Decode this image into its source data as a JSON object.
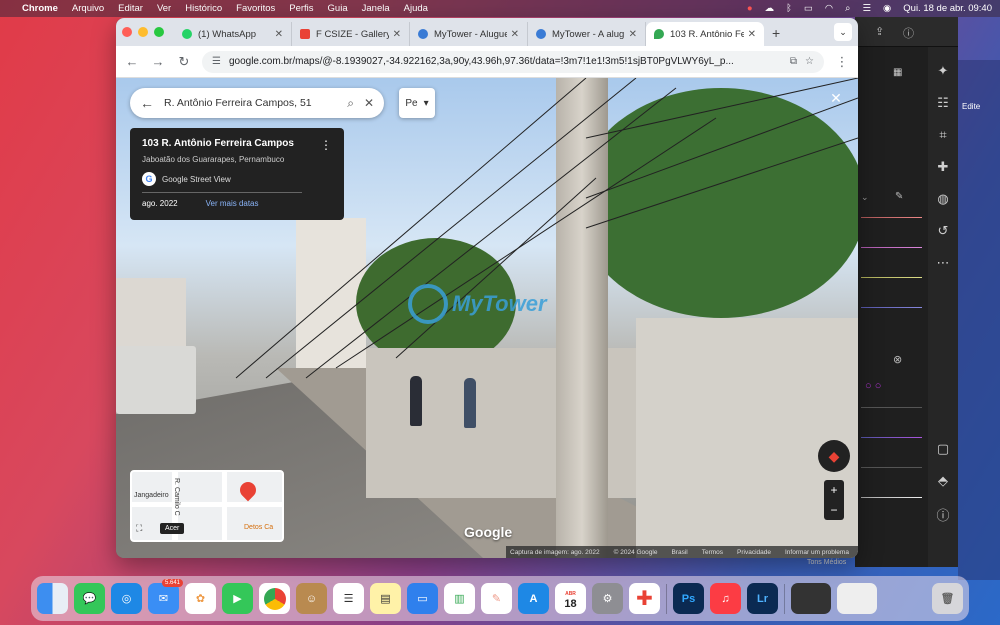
{
  "menubar": {
    "app": "Chrome",
    "items": [
      "Arquivo",
      "Editar",
      "Ver",
      "Histórico",
      "Favoritos",
      "Perfis",
      "Guia",
      "Janela",
      "Ajuda"
    ],
    "datetime": "Qui. 18 de abr.  09:40"
  },
  "tabs": [
    {
      "title": "(1) WhatsApp",
      "color": "#25d366"
    },
    {
      "title": "F CSIZE - Gallery",
      "color": "#e94235"
    },
    {
      "title": "MyTower - Aluguel",
      "color": "#3a7bd5"
    },
    {
      "title": "MyTower - A aluguel",
      "color": "#3a7bd5"
    },
    {
      "title": "103 R. Antônio Fe",
      "color": "#34a853"
    }
  ],
  "omnibox": {
    "url": "google.com.br/maps/@-8.1939027,-34.922162,3a,90y,43.96h,97.36t/data=!3m7!1e1!3m5!1sjBT0PgVLWY6yL_p..."
  },
  "maps": {
    "search_value": "R. Antônio Ferreira Campos, 51",
    "lang_button": "Pe",
    "card": {
      "address": "103 R. Antônio Ferreira Campos",
      "city": "Jaboatão dos Guararapes, Pernambuco",
      "source": "Google Street View",
      "date": "ago. 2022",
      "more_dates": "Ver mais datas"
    },
    "minimap": {
      "label_left": "Jangadeiro",
      "label_street": "R. Camilo C",
      "label_place": "Detos Ca",
      "hint": "Acer"
    },
    "watermark": "MyTower",
    "google": "Google",
    "footer": [
      "Captura de imagem: ago. 2022",
      "© 2024 Google",
      "Brasil",
      "Termos",
      "Privacidade",
      "Informar um problema"
    ]
  },
  "bgapp": {
    "label": "Tons Médios",
    "edit": "Edite"
  },
  "dock": {
    "mail_badge": "5.641",
    "calendar_month": "ABR",
    "calendar_day": "18"
  }
}
